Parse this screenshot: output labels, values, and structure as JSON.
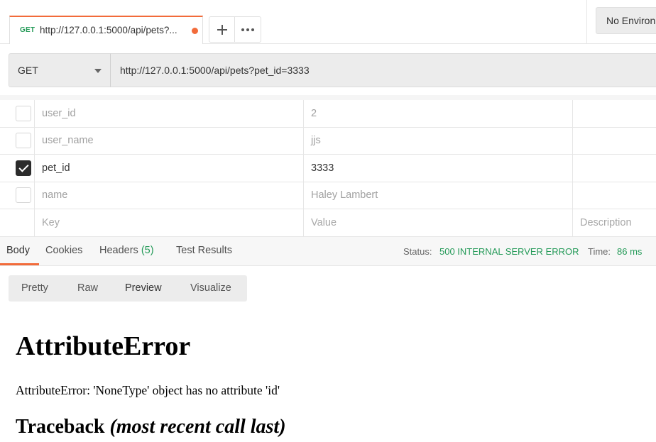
{
  "tab": {
    "method": "GET",
    "url_short": "http://127.0.0.1:5000/api/pets?...",
    "unsaved_color": "#f26b3a"
  },
  "tab_actions": {
    "add_icon": "plus-icon",
    "more_icon": "ellipsis-icon"
  },
  "environment": {
    "selected": "No Environment"
  },
  "request": {
    "method": "GET",
    "url": "http://127.0.0.1:5000/api/pets?pet_id=3333"
  },
  "params": [
    {
      "key": "user_id",
      "value": "2",
      "description": "",
      "enabled": false
    },
    {
      "key": "user_name",
      "value": "jjs",
      "description": "",
      "enabled": false
    },
    {
      "key": "pet_id",
      "value": "3333",
      "description": "",
      "enabled": true
    },
    {
      "key": "name",
      "value": "Haley Lambert",
      "description": "",
      "enabled": false
    }
  ],
  "params_placeholder": {
    "key": "Key",
    "value": "Value",
    "description": "Description"
  },
  "response_tabs": {
    "body": "Body",
    "cookies": "Cookies",
    "headers": "Headers",
    "headers_count": "(5)",
    "test_results": "Test Results"
  },
  "status": {
    "status_label": "Status:",
    "status_value": "500 INTERNAL SERVER ERROR",
    "time_label": "Time:",
    "time_value": "86 ms",
    "status_color": "#249a58"
  },
  "view_modes": [
    "Pretty",
    "Raw",
    "Preview",
    "Visualize"
  ],
  "view_mode_selected": "Preview",
  "preview": {
    "title": "AttributeError",
    "message": "AttributeError: 'NoneType' object has no attribute 'id'",
    "traceback_heading": "Traceback",
    "traceback_note": "(most recent call last)"
  },
  "accent_color": "#f26b3a"
}
